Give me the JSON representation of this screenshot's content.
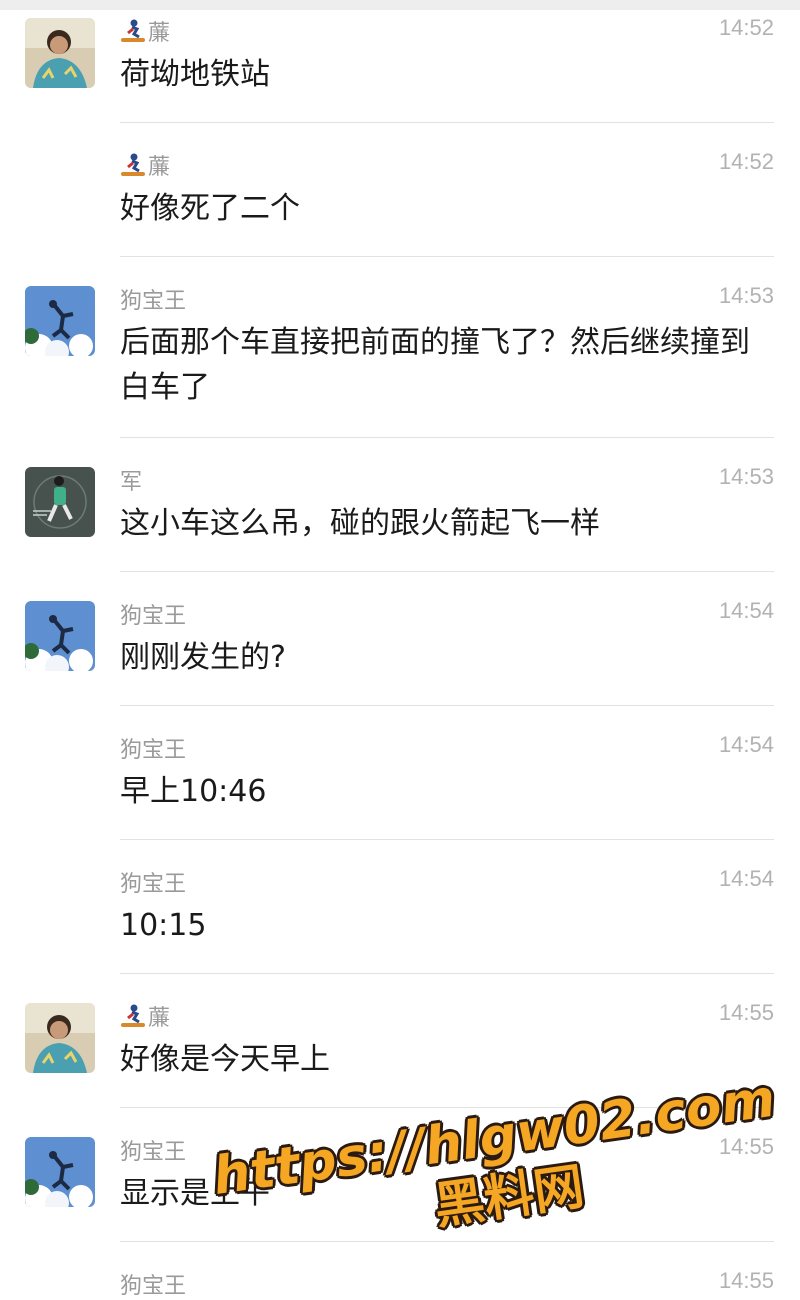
{
  "messages": [
    {
      "sender": "薕",
      "time": "14:52",
      "text": "荷坳地铁站",
      "avatar": "photo-avatar",
      "sender_emoji": "snowboarder-icon"
    },
    {
      "sender": "薕",
      "time": "14:52",
      "text": "好像死了二个",
      "sender_emoji": "snowboarder-icon"
    },
    {
      "sender": "狗宝王",
      "time": "14:53",
      "text": "后面那个车直接把前面的撞飞了？然后继续撞到白车了",
      "avatar": "sky-avatar"
    },
    {
      "sender": "军",
      "time": "14:53",
      "text": "这小车这么吊，碰的跟火箭起飞一样",
      "avatar": "dark-avatar"
    },
    {
      "sender": "狗宝王",
      "time": "14:54",
      "text": "刚刚发生的?",
      "avatar": "sky-avatar"
    },
    {
      "sender": "狗宝王",
      "time": "14:54",
      "text": "早上10:46"
    },
    {
      "sender": "狗宝王",
      "time": "14:54",
      "text": "10:15"
    },
    {
      "sender": "薕",
      "time": "14:55",
      "text": "好像是今天早上",
      "avatar": "photo-avatar",
      "sender_emoji": "snowboarder-icon"
    },
    {
      "sender": "狗宝王",
      "time": "14:55",
      "text": "显示是上午",
      "avatar": "sky-avatar"
    },
    {
      "sender": "狗宝王",
      "time": "14:55",
      "text": ""
    }
  ],
  "watermark": {
    "url": "https://hlgw02.com",
    "name": "黑料网"
  },
  "colors": {
    "name": "#9a9a9a",
    "time": "#b2b2b2",
    "text": "#1a1a1a",
    "watermark": "#f5a623"
  }
}
